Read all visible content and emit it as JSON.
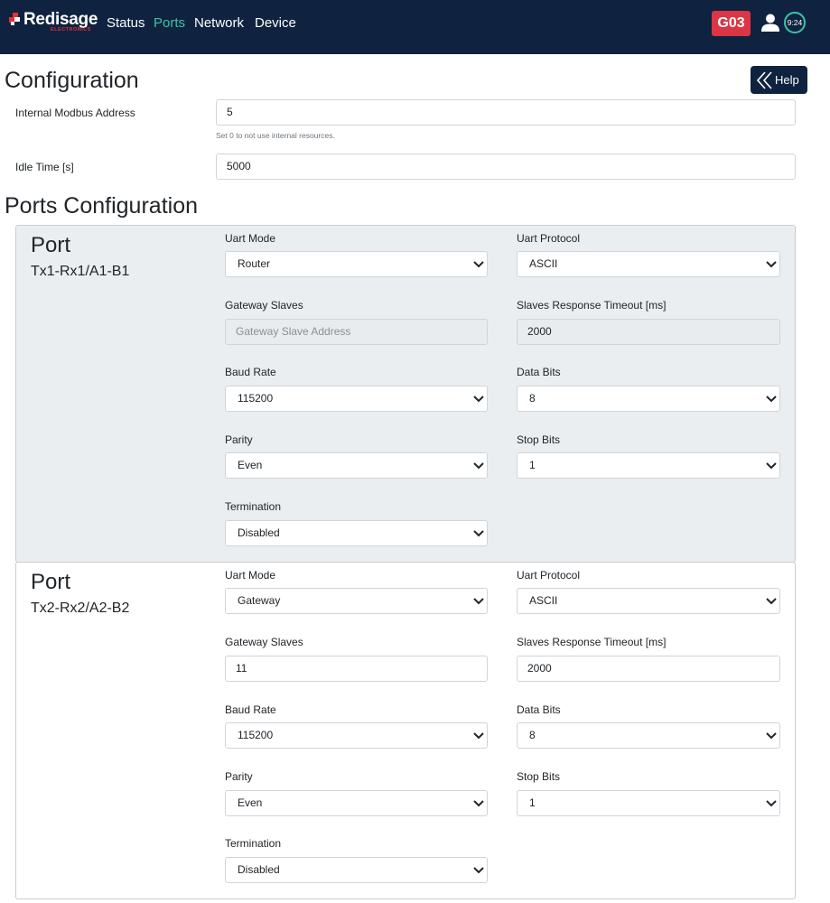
{
  "navbar": {
    "brand": "Redisage",
    "brand_sub": "ELECTRONICS",
    "links": [
      "Status",
      "Ports",
      "Network",
      "Device"
    ],
    "active_link": "Ports",
    "device_badge": "G03",
    "clock": "9:24",
    "colors": {
      "background": "#0f2340",
      "accent": "#3cc4a4",
      "badge": "#dc3545"
    }
  },
  "configuration": {
    "title": "Configuration",
    "help_label": "Help",
    "internal_address_label": "Internal Modbus Address",
    "internal_address_value": "5",
    "internal_address_help": "Set 0 to not use internal resources.",
    "idle_time_label": "Idle Time [s]",
    "idle_time_value": "5000"
  },
  "ports_configuration": {
    "title": "Ports Configuration",
    "ports": [
      {
        "title": "Port",
        "name": "Tx1-Rx1/A1-B1",
        "uart_mode_label": "Uart Mode",
        "uart_mode": "Router",
        "uart_protocol_label": "Uart Protocol",
        "uart_protocol": "ASCII",
        "gateway_slaves_label": "Gateway Slaves",
        "gateway_slaves_placeholder": "Gateway Slave Address",
        "gateway_slaves_value": "",
        "timeout_label": "Slaves Response Timeout [ms]",
        "timeout_value": "2000",
        "baud_rate_label": "Baud Rate",
        "baud_rate": "115200",
        "data_bits_label": "Data Bits",
        "data_bits": "8",
        "parity_label": "Parity",
        "parity": "Even",
        "stop_bits_label": "Stop Bits",
        "stop_bits": "1",
        "termination_label": "Termination",
        "termination": "Disabled"
      },
      {
        "title": "Port",
        "name": "Tx2-Rx2/A2-B2",
        "uart_mode_label": "Uart Mode",
        "uart_mode": "Gateway",
        "uart_protocol_label": "Uart Protocol",
        "uart_protocol": "ASCII",
        "gateway_slaves_label": "Gateway Slaves",
        "gateway_slaves_value": "11",
        "timeout_label": "Slaves Response Timeout [ms]",
        "timeout_value": "2000",
        "baud_rate_label": "Baud Rate",
        "baud_rate": "115200",
        "data_bits_label": "Data Bits",
        "data_bits": "8",
        "parity_label": "Parity",
        "parity": "Even",
        "stop_bits_label": "Stop Bits",
        "stop_bits": "1",
        "termination_label": "Termination",
        "termination": "Disabled"
      }
    ]
  }
}
